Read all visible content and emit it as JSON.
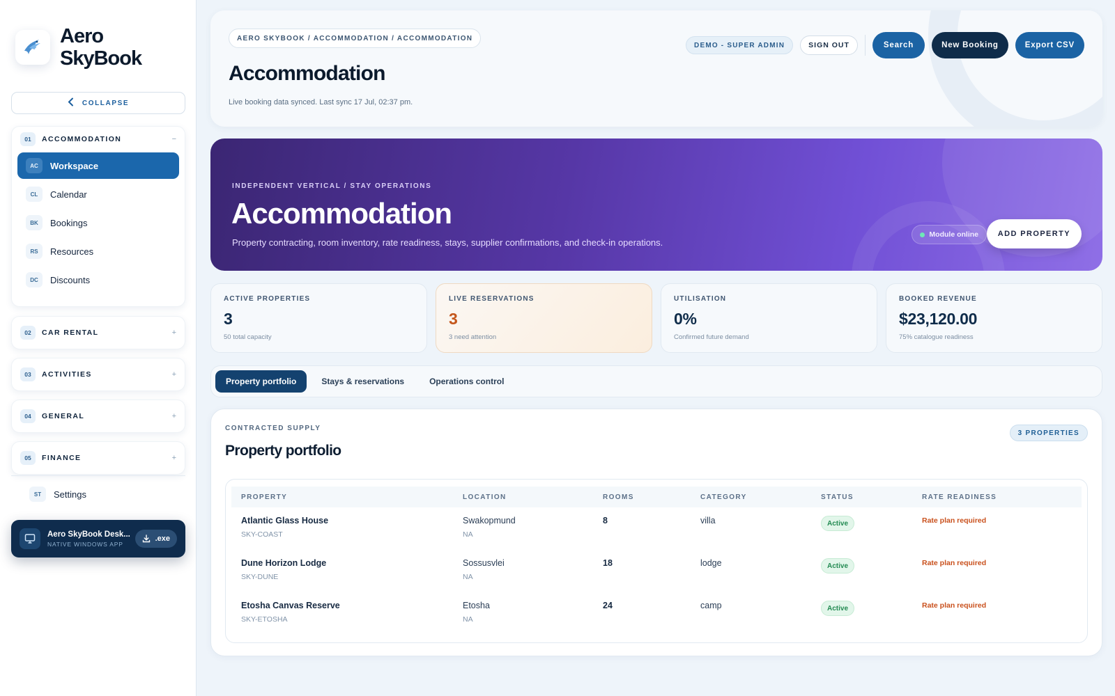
{
  "brand": {
    "name": "Aero SkyBook"
  },
  "sidebar": {
    "collapse_label": "COLLAPSE",
    "groups": [
      {
        "num": "01",
        "label": "ACCOMMODATION",
        "toggle": "−",
        "items": [
          {
            "abbr": "AC",
            "label": "Workspace",
            "active": true
          },
          {
            "abbr": "CL",
            "label": "Calendar"
          },
          {
            "abbr": "BK",
            "label": "Bookings"
          },
          {
            "abbr": "RS",
            "label": "Resources"
          },
          {
            "abbr": "DC",
            "label": "Discounts"
          }
        ]
      },
      {
        "num": "02",
        "label": "CAR RENTAL",
        "toggle": "+"
      },
      {
        "num": "03",
        "label": "ACTIVITIES",
        "toggle": "+"
      },
      {
        "num": "04",
        "label": "GENERAL",
        "toggle": "+"
      },
      {
        "num": "05",
        "label": "FINANCE",
        "toggle": "+"
      }
    ],
    "settings": {
      "abbr": "ST",
      "label": "Settings"
    },
    "desktop": {
      "title": "Aero SkyBook Desk...",
      "subtitle": "NATIVE WINDOWS APP",
      "download_label": ".exe"
    }
  },
  "header": {
    "breadcrumb": "AERO SKYBOOK / ACCOMMODATION / ACCOMMODATION",
    "title": "Accommodation",
    "sync_text": "Live booking data synced. Last sync 17 Jul, 02:37 pm.",
    "role_chip": "DEMO - SUPER ADMIN",
    "sign_out": "SIGN OUT",
    "search": "Search",
    "new_booking": "New Booking",
    "export_csv": "Export CSV"
  },
  "hero": {
    "eyebrow": "INDEPENDENT VERTICAL / STAY OPERATIONS",
    "title": "Accommodation",
    "description": "Property contracting, room inventory, rate readiness, stays, supplier confirmations, and check-in operations.",
    "status": "Module online",
    "add_property": "ADD PROPERTY"
  },
  "kpis": [
    {
      "label": "ACTIVE PROPERTIES",
      "value": "3",
      "sub": "50 total capacity"
    },
    {
      "label": "LIVE RESERVATIONS",
      "value": "3",
      "sub": "3 need attention",
      "warn": true
    },
    {
      "label": "UTILISATION",
      "value": "0%",
      "sub": "Confirmed future demand"
    },
    {
      "label": "BOOKED REVENUE",
      "value": "$23,120.00",
      "sub": "75% catalogue readiness"
    }
  ],
  "tabs": [
    {
      "label": "Property portfolio",
      "active": true
    },
    {
      "label": "Stays & reservations"
    },
    {
      "label": "Operations control"
    }
  ],
  "portfolio": {
    "eyebrow": "CONTRACTED SUPPLY",
    "title": "Property portfolio",
    "count": "3 PROPERTIES",
    "columns": [
      "PROPERTY",
      "LOCATION",
      "ROOMS",
      "CATEGORY",
      "STATUS",
      "RATE READINESS"
    ],
    "rows": [
      {
        "name": "Atlantic Glass House",
        "code": "SKY-COAST",
        "city": "Swakopmund",
        "country": "NA",
        "rooms": "8",
        "category": "villa",
        "status": "Active",
        "rate": "Rate plan required"
      },
      {
        "name": "Dune Horizon Lodge",
        "code": "SKY-DUNE",
        "city": "Sossusvlei",
        "country": "NA",
        "rooms": "18",
        "category": "lodge",
        "status": "Active",
        "rate": "Rate plan required"
      },
      {
        "name": "Etosha Canvas Reserve",
        "code": "SKY-ETOSHA",
        "city": "Etosha",
        "country": "NA",
        "rooms": "24",
        "category": "camp",
        "status": "Active",
        "rate": "Rate plan required"
      }
    ]
  },
  "colors": {
    "primary": "#1b63a4",
    "navy": "#0f2c4a",
    "hero_start": "#3b2673",
    "hero_end": "#8f6fe6",
    "warn": "#c4561b",
    "success": "#238a52"
  },
  "icons": {
    "logo": "bird-logo-icon",
    "collapse": "chevron-left-icon",
    "desktop": "monitor-icon",
    "download": "download-icon"
  }
}
